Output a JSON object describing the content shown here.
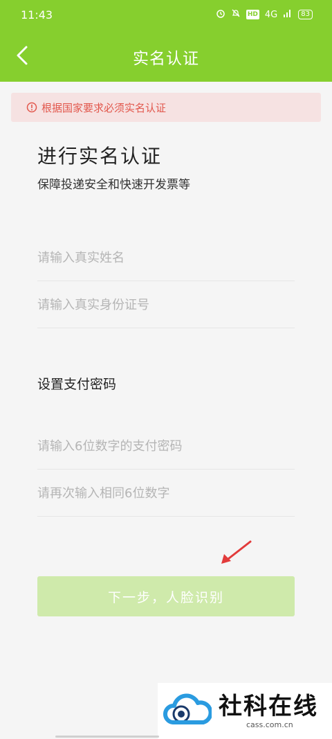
{
  "status_bar": {
    "time": "11:43",
    "network": "4G",
    "battery": "83",
    "hd_badge": "HD"
  },
  "header": {
    "title": "实名认证"
  },
  "alert": {
    "text": "根据国家要求必须实名认证"
  },
  "form": {
    "heading": "进行实名认证",
    "subheading": "保障投递安全和快速开发票等",
    "name_placeholder": "请输入真实姓名",
    "id_placeholder": "请输入真实身份证号",
    "password_section_label": "设置支付密码",
    "password_placeholder": "请输入6位数字的支付密码",
    "password_confirm_placeholder": "请再次输入相同6位数字",
    "submit_label": "下一步，人脸识别"
  },
  "watermark": {
    "name": "社科在线",
    "domain": "cass.com.cn"
  },
  "colors": {
    "brand_green": "#86cf2e",
    "button_disabled": "#cfeaab",
    "alert_red": "#e2574c",
    "alert_bg": "#f6e2e2"
  }
}
